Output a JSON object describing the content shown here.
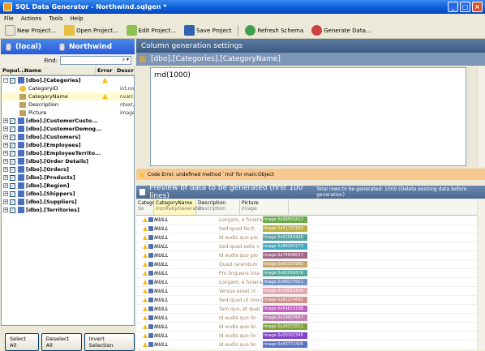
{
  "window": {
    "title": "SQL Data Generator - Northwind.sqlgen *"
  },
  "menu": [
    "File",
    "Actions",
    "Tools",
    "Help"
  ],
  "toolbar": [
    "New Project...",
    "Open Project...",
    "Edit Project...",
    "Save Project",
    "Refresh Schema",
    "Generate Data..."
  ],
  "connection": {
    "server": "(local)",
    "database": "Northwind"
  },
  "find": {
    "label": "Find:"
  },
  "list_headers": [
    "Popul...",
    "Name",
    "Error",
    "Descr"
  ],
  "tree": {
    "first_table": "[dbo].[Categories]",
    "columns": [
      {
        "name": "CategoryID",
        "desc": "int,not",
        "warn": false,
        "icon": "key"
      },
      {
        "name": "CategoryName",
        "desc": "nvarch",
        "warn": true,
        "icon": "col"
      },
      {
        "name": "Description",
        "desc": "ntext,n",
        "warn": false,
        "icon": "col"
      },
      {
        "name": "Picture",
        "desc": "image,n",
        "warn": false,
        "icon": "col"
      }
    ],
    "tables": [
      "[dbo].[CustomerCusto...",
      "[dbo].[CustomerDemog...",
      "[dbo].[Customers]",
      "[dbo].[Employees]",
      "[dbo].[EmployeeTerrito...",
      "[dbo].[Order Details]",
      "[dbo].[Orders]",
      "[dbo].[Products]",
      "[dbo].[Region]",
      "[dbo].[Shippers]",
      "[dbo].[Suppliers]",
      "[dbo].[Territories]"
    ]
  },
  "left_buttons": [
    "Select All",
    "Deselect All",
    "Invert Selection"
  ],
  "settings": {
    "title": "Column generation settings",
    "column": "[dbo].[Categories].[CategoryName]",
    "expression": "rnd(1000)"
  },
  "error": {
    "text": "Code Error. undefined method `rnd' for main:Object"
  },
  "preview": {
    "title": "Preview of data to be generated (first 100 lines)",
    "info": "Total rows to be generated: 1000 (Delete existing data before generation)",
    "headers": [
      {
        "name": "Catego",
        "sub": "Se"
      },
      {
        "name": "CategoryName",
        "sub": "IronRubyGenerator"
      },
      {
        "name": "Description",
        "sub": "Description"
      },
      {
        "name": "Picture",
        "sub": "Image"
      }
    ],
    "rows": [
      {
        "name": "NULL",
        "desc": "Longam, e funera",
        "img": "Image 0x98503A12",
        "color": "#6aa84a"
      },
      {
        "name": "NULL",
        "desc": "Sed quad fecit,",
        "img": "Image 0x51722163",
        "color": "#b8b040"
      },
      {
        "name": "NULL",
        "desc": "Id eudis quo plo",
        "img": "Image 0x92810426",
        "color": "#58a0a0"
      },
      {
        "name": "NULL",
        "desc": "Sed quad estis v",
        "img": "Image 0x89250173",
        "color": "#40a8c0"
      },
      {
        "name": "NULL",
        "desc": "Id eudis quo plo",
        "img": "Image 0x74638017",
        "color": "#a06888"
      },
      {
        "name": "NULL",
        "desc": "Quad rarendum",
        "img": "Image 0x63107283",
        "color": "#c8a870"
      },
      {
        "name": "NULL",
        "desc": "Pro linguens ima",
        "img": "Image 0x62018376",
        "color": "#58a8a0"
      },
      {
        "name": "NULL",
        "desc": "Longam, e funera",
        "img": "Image 0x40177021",
        "color": "#7090c8"
      },
      {
        "name": "NULL",
        "desc": "Versus esset in",
        "img": "Image 0x39012846",
        "color": "#e0a8b0"
      },
      {
        "name": "NULL",
        "desc": "Sed quad ut novu",
        "img": "Image 0x81274562",
        "color": "#d09088"
      },
      {
        "name": "NULL",
        "desc": "Tam quo, et quar",
        "img": "Image 0x54623108",
        "color": "#c060c0"
      },
      {
        "name": "NULL",
        "desc": "Id eudis quo lin",
        "img": "Image 0x18823647",
        "color": "#c080b0"
      },
      {
        "name": "NULL",
        "desc": "Id eudis quo lin",
        "img": "Image 0x26372011",
        "color": "#80a040"
      },
      {
        "name": "NULL",
        "desc": "Id eudis quo lin",
        "img": "Image 0x00162345",
        "color": "#8040c8"
      },
      {
        "name": "NULL",
        "desc": "Id eudis quo lin",
        "img": "Image 0x83772406",
        "color": "#5870c0"
      },
      {
        "name": "NULL",
        "desc": "Quad rarendum",
        "img": "Image 0x77812903",
        "color": "#50b060"
      }
    ]
  }
}
